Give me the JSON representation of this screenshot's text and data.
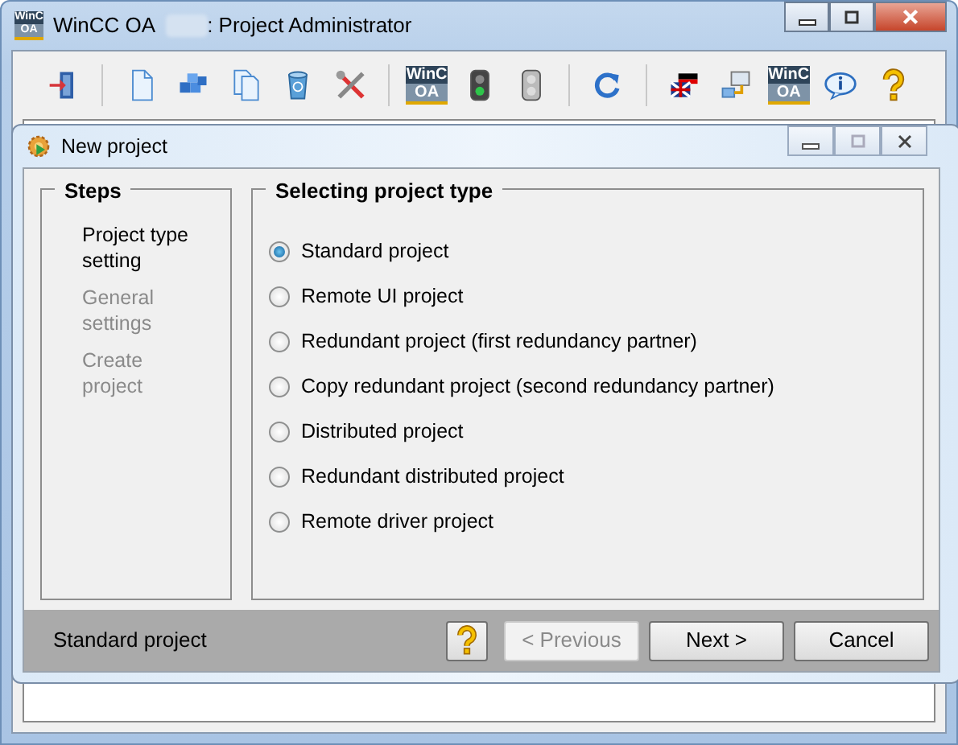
{
  "window": {
    "logo_top": "WinC",
    "logo_bottom": "OA",
    "title_prefix": "WinCC OA",
    "title_suffix": ": Project Administrator"
  },
  "toolbar": [
    {
      "kind": "exit"
    },
    {
      "kind": "separator"
    },
    {
      "kind": "file"
    },
    {
      "kind": "blocks"
    },
    {
      "kind": "copy"
    },
    {
      "kind": "bin"
    },
    {
      "kind": "tools"
    },
    {
      "kind": "separator"
    },
    {
      "kind": "logo",
      "top": "WinC",
      "bottom": "OA"
    },
    {
      "kind": "light",
      "on": true
    },
    {
      "kind": "light",
      "on": false
    },
    {
      "kind": "separator"
    },
    {
      "kind": "refresh"
    },
    {
      "kind": "separator"
    },
    {
      "kind": "flags"
    },
    {
      "kind": "network"
    },
    {
      "kind": "logo",
      "top": "WinC",
      "bottom": "OA"
    },
    {
      "kind": "spacer"
    },
    {
      "kind": "info"
    },
    {
      "kind": "help"
    }
  ],
  "dialog": {
    "title": "New project",
    "steps_heading": "Steps",
    "steps": [
      {
        "label": "Project type setting",
        "active": true
      },
      {
        "label": "General settings",
        "active": false
      },
      {
        "label": "Create project",
        "active": false
      }
    ],
    "options_heading": "Selecting project type",
    "options": [
      {
        "label": "Standard project",
        "selected": true
      },
      {
        "label": "Remote UI project",
        "selected": false
      },
      {
        "label": "Redundant project (first redundancy partner)",
        "selected": false
      },
      {
        "label": "Copy redundant project (second redundancy partner)",
        "selected": false
      },
      {
        "label": "Distributed project",
        "selected": false
      },
      {
        "label": "Redundant distributed project",
        "selected": false
      },
      {
        "label": "Remote driver project",
        "selected": false
      }
    ],
    "status": "Standard project",
    "buttons": [
      {
        "kind": "help"
      },
      {
        "kind": "text",
        "label": "< Previous",
        "disabled": true
      },
      {
        "kind": "text",
        "label": "Next >",
        "disabled": false
      },
      {
        "kind": "text",
        "label": "Cancel",
        "disabled": false
      }
    ]
  }
}
